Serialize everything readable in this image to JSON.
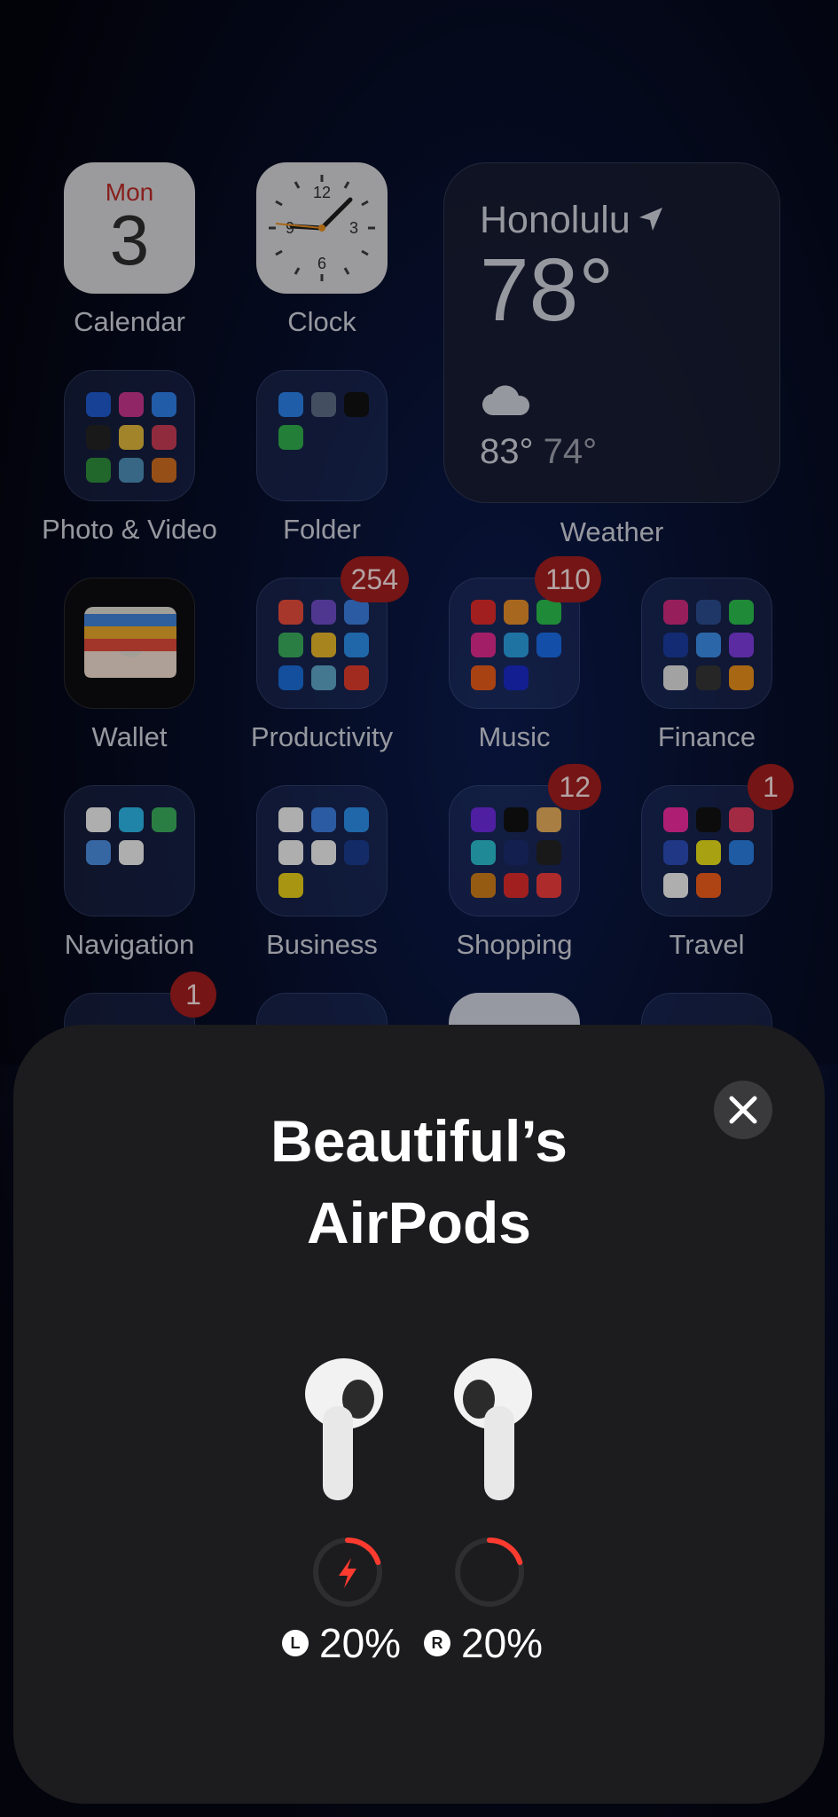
{
  "apps": {
    "calendar": {
      "label": "Calendar",
      "weekday": "Mon",
      "day": "3"
    },
    "clock": {
      "label": "Clock",
      "numbers": [
        "12",
        "3",
        "6",
        "9"
      ]
    },
    "photo_video": {
      "label": "Photo & Video"
    },
    "folder": {
      "label": "Folder"
    },
    "wallet": {
      "label": "Wallet"
    },
    "productivity": {
      "label": "Productivity",
      "badge": "254"
    },
    "music": {
      "label": "Music",
      "badge": "110"
    },
    "finance": {
      "label": "Finance"
    },
    "navigation": {
      "label": "Navigation"
    },
    "business": {
      "label": "Business"
    },
    "shopping": {
      "label": "Shopping",
      "badge": "12"
    },
    "travel": {
      "label": "Travel",
      "badge": "1"
    },
    "row5_folder": {
      "badge": "1"
    }
  },
  "weather": {
    "city": "Honolulu",
    "temperature": "78°",
    "high": "83°",
    "low": "74°",
    "label": "Weather"
  },
  "airpods_sheet": {
    "title_line1": "Beautiful’s",
    "title_line2": "AirPods",
    "left": {
      "side": "L",
      "battery_text": "20%",
      "battery_level": 0.2,
      "charging": true
    },
    "right": {
      "side": "R",
      "battery_text": "20%",
      "battery_level": 0.2,
      "charging": false
    }
  },
  "colors": {
    "badge": "#9d1c1c",
    "battery_low": "#ff3b30",
    "sheet_bg": "#1c1c1e"
  }
}
